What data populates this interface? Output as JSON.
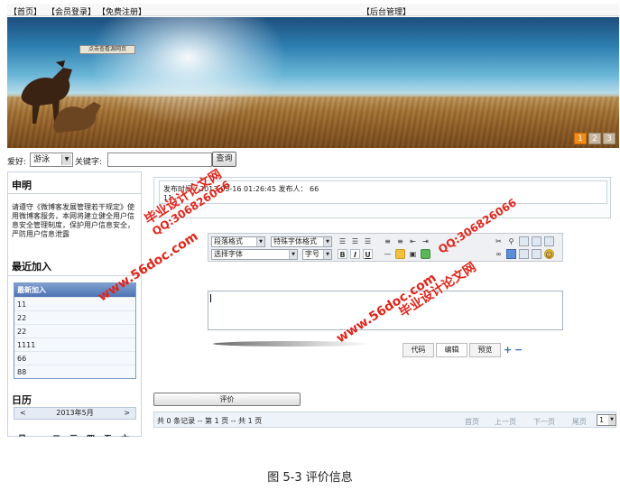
{
  "nav": {
    "home": "【首页】",
    "login": "【会员登录】",
    "register": "【免费注册】",
    "admin": "【后台管理】"
  },
  "banner": {
    "view_link": "点击查看源网页",
    "pages": [
      "1",
      "2",
      "3"
    ],
    "active_page": 1
  },
  "search": {
    "hobby_label": "爱好:",
    "hobby_value": "游泳",
    "keyword_label": "关键字:",
    "keyword_value": "",
    "query_label": "查询"
  },
  "sidebar": {
    "notice_title": "申明",
    "notice_text": "请遵守《微博客发展管理若干规定》使用微博客服务，本网将建立健全用户信息安全管理制度，保护用户信息安全，严防用户信息泄露",
    "recent_title": "最近加入",
    "recent_header": "最新加入",
    "recent_items": [
      "11",
      "22",
      "22",
      "1111",
      "66",
      "88"
    ],
    "calendar_title": "日历",
    "calendar_prev": "<",
    "calendar_next": ">",
    "calendar_month": "2013年5月",
    "weekdays": [
      "日",
      "一",
      "二",
      "三",
      "四",
      "五",
      "六"
    ]
  },
  "post": {
    "meta": "发布时间：2013-05-16 01:26:45 发布人：  66",
    "body": "11"
  },
  "editor": {
    "paragraph_format": "段落格式",
    "special_format": "特殊字体格式",
    "font_select": "选择字体",
    "size_select": "字号",
    "bold": "B",
    "italic": "I",
    "underline": "U",
    "tabs": [
      "代码",
      "编辑",
      "预览"
    ],
    "active_tab": "编辑",
    "icons": [
      "align-left-icon",
      "align-center-icon",
      "align-right-icon",
      "ordered-list-icon",
      "unordered-list-icon",
      "outdent-icon",
      "indent-icon",
      "cut-icon",
      "find-icon",
      "copy-icon",
      "paste-icon",
      "print-icon",
      "horizontal-rule-icon",
      "image-icon",
      "flash-icon",
      "media-icon",
      "link-icon",
      "table-icon",
      "special-char-icon",
      "emoticon-icon",
      "zoom-in-icon",
      "zoom-out-icon"
    ]
  },
  "comment_button": "评价",
  "pager": {
    "info": "共 0 条记录 -- 第 1 页 -- 共 1 页",
    "first": "首页",
    "prev": "上一页",
    "next": "下一页",
    "last": "尾页",
    "page_value": "1"
  },
  "watermarks": {
    "site": "www.56doc.com",
    "qq": "QQ:306826066",
    "brand": "毕业设计论文网"
  },
  "caption": "图 5-3 评价信息",
  "colors": {
    "accent_orange": "#f28c18",
    "list_header_blue": "#4f74b3",
    "watermark_red": "#e0251b"
  }
}
